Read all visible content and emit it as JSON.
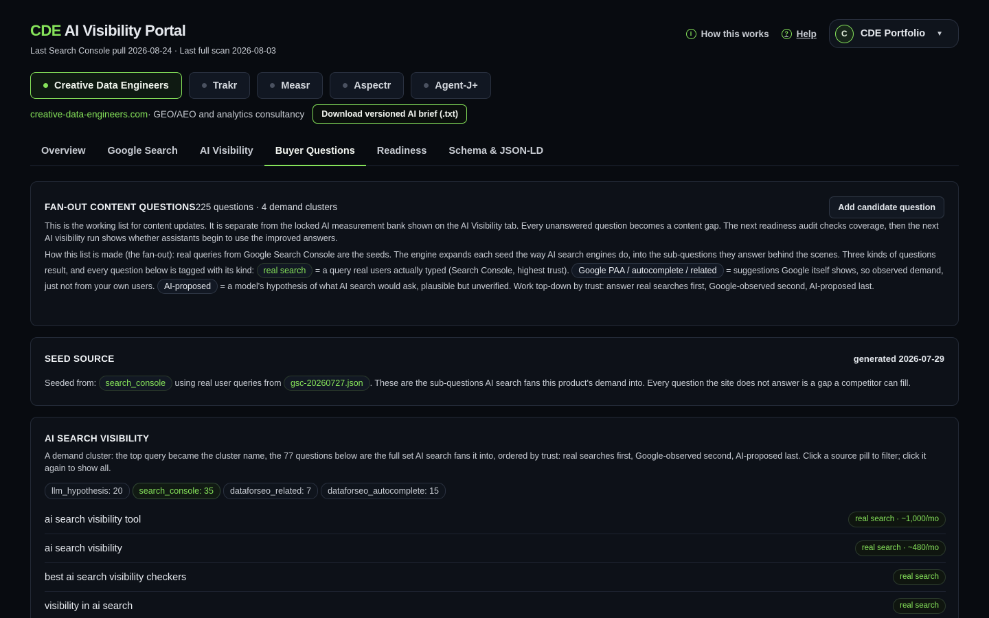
{
  "header": {
    "brand_accent": "CDE",
    "brand_rest": "AI Visibility Portal",
    "subline": "Last Search Console pull 2026-08-24 · Last full scan 2026-08-03",
    "how_label": "How this works",
    "help_label": "Help",
    "portfolio_initial": "C",
    "portfolio_label": "CDE Portfolio"
  },
  "projects": [
    {
      "label": "Creative Data Engineers",
      "active": true
    },
    {
      "label": "Trakr"
    },
    {
      "label": "Measr"
    },
    {
      "label": "Aspectr"
    },
    {
      "label": "Agent-J+"
    }
  ],
  "siteline": {
    "site": "creative-data-engineers.com",
    "description": " · GEO/AEO and analytics consultancy",
    "download_label": "Download versioned AI brief (.txt)"
  },
  "tabs": [
    {
      "label": "Overview"
    },
    {
      "label": "Google Search"
    },
    {
      "label": "AI Visibility"
    },
    {
      "label": "Buyer Questions",
      "active": true
    },
    {
      "label": "Readiness"
    },
    {
      "label": "Schema & JSON-LD"
    }
  ],
  "fanout": {
    "title": "FAN-OUT CONTENT QUESTIONS",
    "meta": "225 questions · 4 demand clusters",
    "add_label": "Add candidate question",
    "p1": "This is the working list for content updates. It is separate from the locked AI measurement bank shown on the AI Visibility tab. Every unanswered question becomes a content gap. The next readiness audit checks coverage, then the next AI visibility run shows whether assistants begin to use the improved answers.",
    "p2a": "How this list is made (the fan-out): real queries from Google Search Console are the seeds. The engine expands each seed the way AI search engines do, into the sub-questions they answer behind the scenes. Three kinds of questions result, and every question below is tagged with its kind: ",
    "pill_real": "real search",
    "p2b": " = a query real users actually typed (Search Console, highest trust). ",
    "pill_google": "Google PAA / autocomplete / related",
    "p2c": " = suggestions Google itself shows, so observed demand, just not from your own users. ",
    "pill_ai": "AI-proposed",
    "p2d": " = a model's hypothesis of what AI search would ask, plausible but unverified. Work top-down by trust: answer real searches first, Google-observed second, AI-proposed last."
  },
  "seed": {
    "title": "SEED SOURCE",
    "generated": "generated 2026-07-29",
    "prefix": "Seeded from: ",
    "source_pill": "search_console",
    "middle": " using real user queries from ",
    "file_pill": "gsc-20260727.json",
    "suffix": ". These are the sub-questions AI search fans this product's demand into. Every question the site does not answer is a gap a competitor can fill."
  },
  "cluster": {
    "title": "AI SEARCH VISIBILITY",
    "description": "A demand cluster: the top query became the cluster name, the 77 questions below are the full set AI search fans it into, ordered by trust: real searches first, Google-observed second, AI-proposed last. Click a source pill to filter; click it again to show all.",
    "filters": [
      {
        "label": "llm_hypothesis: 20"
      },
      {
        "label": "search_console: 35",
        "active": true
      },
      {
        "label": "dataforseo_related: 7"
      },
      {
        "label": "dataforseo_autocomplete: 15"
      }
    ],
    "questions": [
      {
        "text": "ai search visibility tool",
        "badge": "real search · ~1,000/mo"
      },
      {
        "text": "ai search visibility",
        "badge": "real search · ~480/mo"
      },
      {
        "text": "best ai search visibility checkers",
        "badge": "real search"
      },
      {
        "text": "visibility in ai search",
        "badge": "real search"
      }
    ]
  },
  "colors": {
    "accent": "#86e35a",
    "background": "#080b10",
    "card": "#0d1118"
  }
}
